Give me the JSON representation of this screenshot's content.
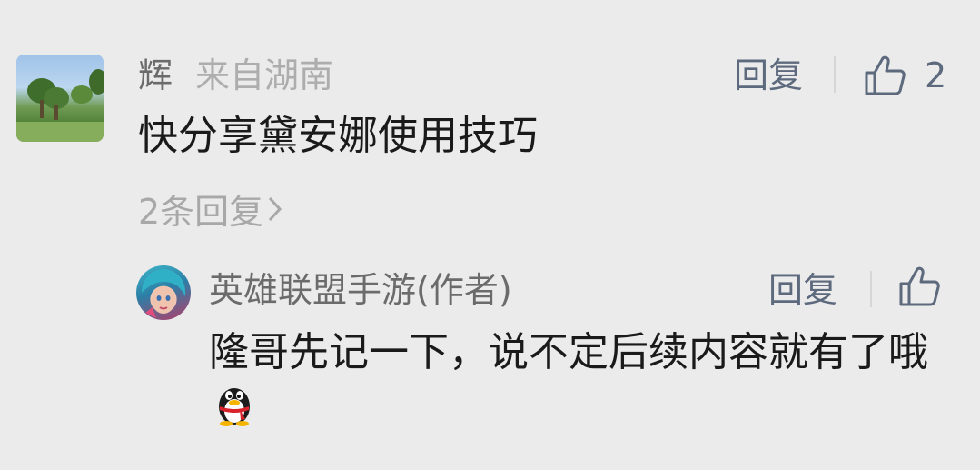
{
  "comment": {
    "author": "辉",
    "location": "来自湖南",
    "reply_label": "回复",
    "like_count": "2",
    "content": "快分享黛安娜使用技巧",
    "reply_count_label": "2条回复"
  },
  "reply": {
    "author": "英雄联盟手游(作者)",
    "reply_label": "回复",
    "content": "隆哥先记一下，说不定后续内容就有了哦",
    "emoji": "qq-penguin-icon"
  },
  "colors": {
    "background": "#ebebeb",
    "action": "#5d6a7e",
    "muted": "#a8a8a8",
    "text": "#1a1a1a"
  }
}
